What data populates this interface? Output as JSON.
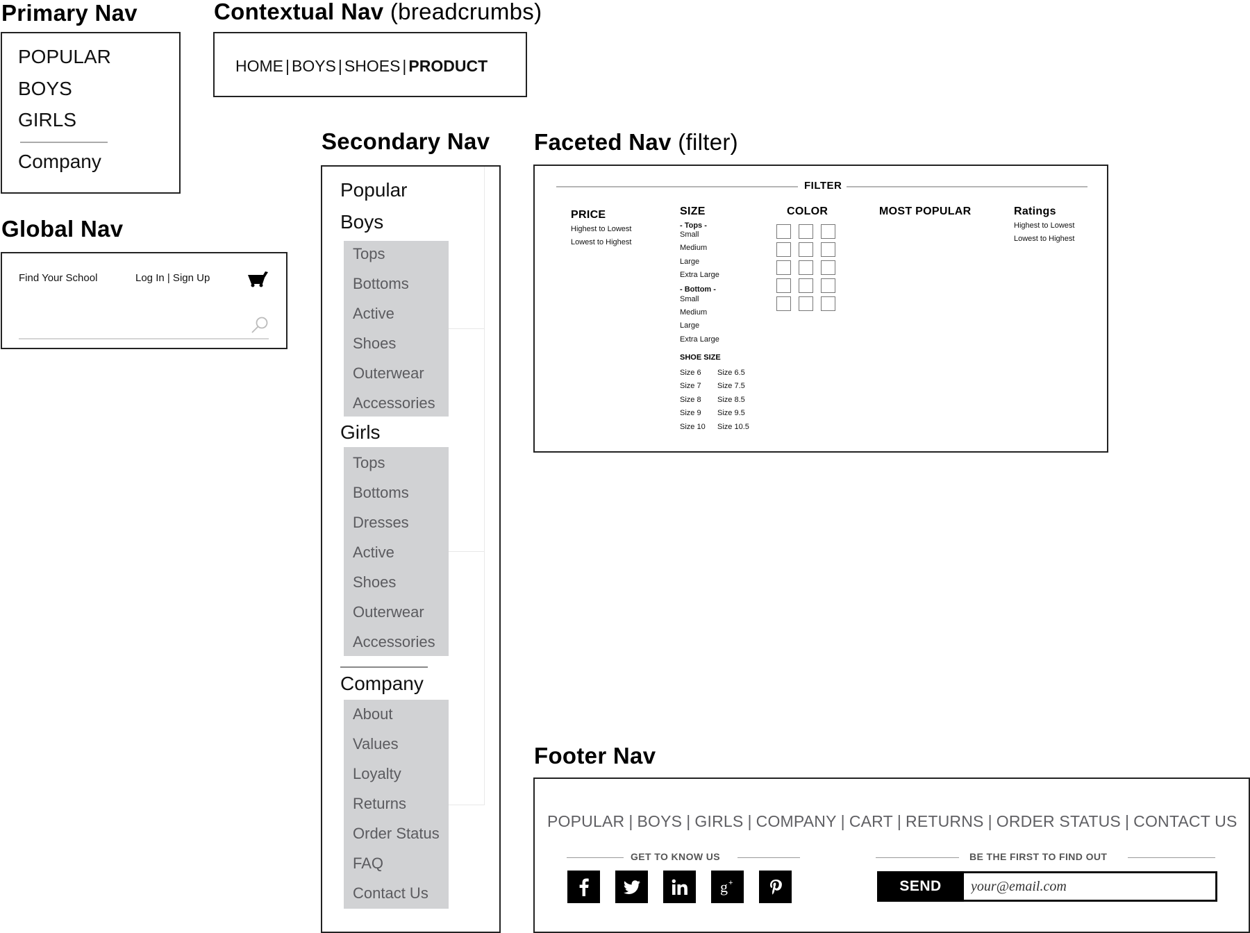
{
  "primary_nav": {
    "title": "Primary Nav",
    "items": [
      "POPULAR",
      "BOYS",
      "GIRLS"
    ],
    "company": "Company"
  },
  "contextual_nav": {
    "title": "Contextual Nav",
    "subtitle": "(breadcrumbs)",
    "crumbs": [
      "HOME",
      "BOYS",
      "SHOES"
    ],
    "current": "PRODUCT",
    "separator": "|"
  },
  "global_nav": {
    "title": "Global Nav",
    "find_school": "Find Your School",
    "login": "Log In | Sign Up",
    "cart_icon": "cart-icon",
    "search_icon": "search-icon",
    "search_placeholder": ""
  },
  "secondary_nav": {
    "title": "Secondary Nav",
    "popular": "Popular",
    "boys": {
      "label": "Boys",
      "items": [
        "Tops",
        "Bottoms",
        "Active",
        "Shoes",
        "Outerwear",
        "Accessories"
      ]
    },
    "girls": {
      "label": "Girls",
      "items": [
        "Tops",
        "Bottoms",
        "Dresses",
        "Active",
        "Shoes",
        "Outerwear",
        "Accessories"
      ]
    },
    "company": {
      "label": "Company",
      "items": [
        "About",
        "Values",
        "Loyalty",
        "Returns",
        "Order Status",
        "FAQ",
        "Contact Us"
      ]
    }
  },
  "faceted_nav": {
    "title": "Faceted Nav",
    "subtitle": "(filter)",
    "filter_label": "FILTER",
    "price": {
      "label": "PRICE",
      "options": [
        "Highest to Lowest",
        "Lowest to Highest"
      ]
    },
    "size": {
      "label": "SIZE",
      "tops_label": "- Tops -",
      "tops": [
        "Small",
        "Medium",
        "Large",
        "Extra Large"
      ],
      "bottom_label": "- Bottom -",
      "bottom": [
        "Small",
        "Medium",
        "Large",
        "Extra Large"
      ]
    },
    "shoe_size": {
      "label": "SHOE SIZE",
      "left": [
        "Size 6",
        "Size 7",
        "Size 8",
        "Size 9",
        "Size 10"
      ],
      "right": [
        "Size 6.5",
        "Size 7.5",
        "Size 8.5",
        "Size 9.5",
        "Size 10.5"
      ]
    },
    "color": {
      "label": "COLOR",
      "rows": 5,
      "cols": 3
    },
    "most_popular": {
      "label": "MOST POPULAR"
    },
    "ratings": {
      "label": "Ratings",
      "options": [
        "Highest to Lowest",
        "Lowest to Highest"
      ]
    }
  },
  "footer_nav": {
    "title": "Footer Nav",
    "links": [
      "POPULAR",
      "BOYS",
      "GIRLS",
      "COMPANY",
      "CART",
      "RETURNS",
      "ORDER STATUS",
      "CONTACT US"
    ],
    "separator": "|",
    "get_to_know": "GET TO KNOW US",
    "social": [
      "facebook-icon",
      "twitter-icon",
      "linkedin-icon",
      "google-plus-icon",
      "pinterest-icon"
    ],
    "be_first": "BE THE FIRST TO FIND OUT",
    "send_label": "SEND",
    "email_placeholder": "your@email.com"
  },
  "colors": {
    "border": "#222222",
    "submenu_bg": "#d1d2d4",
    "submenu_text": "#5b5b5f",
    "footer_text": "#5f5f63",
    "button_bg": "#000000"
  }
}
